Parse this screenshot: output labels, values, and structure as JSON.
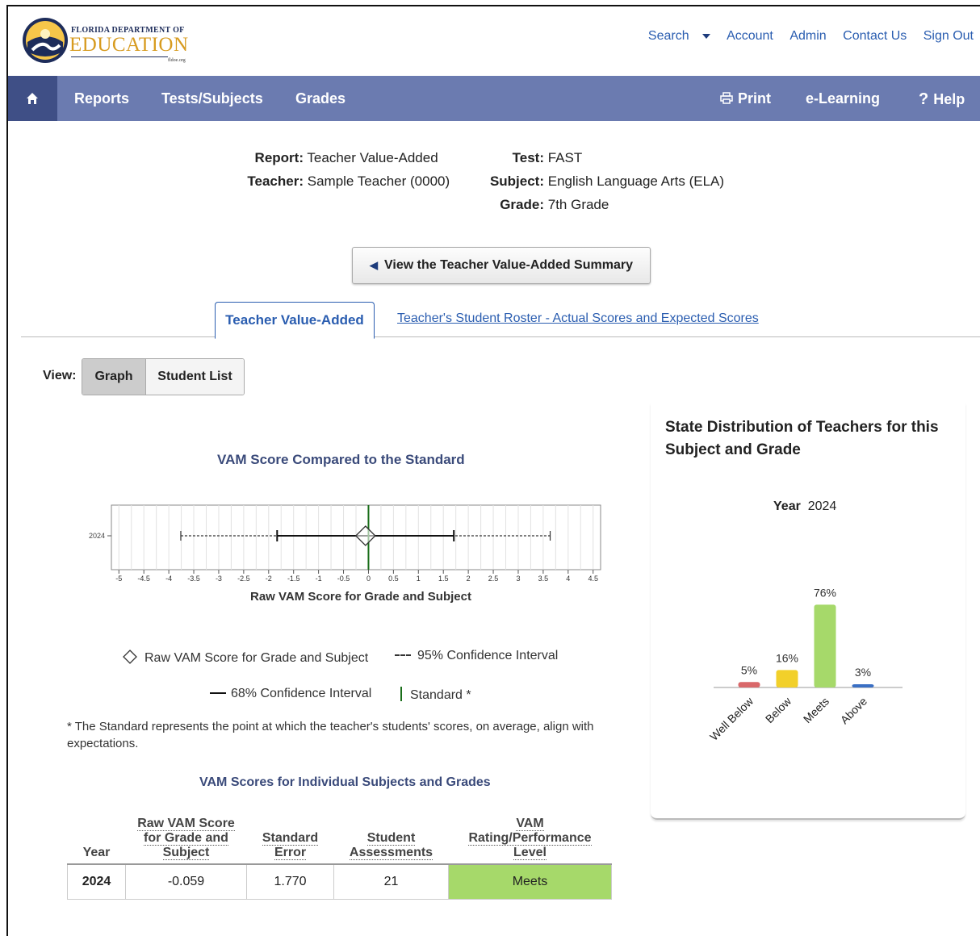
{
  "header": {
    "logo_line1": "FLORIDA DEPARTMENT OF",
    "logo_line2": "EDUCATION",
    "logo_line3": "fldoe.org",
    "links": {
      "search": "Search",
      "account": "Account",
      "admin": "Admin",
      "contact": "Contact Us",
      "signout": "Sign Out"
    }
  },
  "nav": {
    "reports": "Reports",
    "tests": "Tests/Subjects",
    "grades": "Grades",
    "print": "Print",
    "elearning": "e-Learning",
    "help": "Help"
  },
  "report": {
    "report_label": "Report:",
    "report_value": "Teacher Value-Added",
    "teacher_label": "Teacher:",
    "teacher_value": "Sample Teacher (0000)",
    "test_label": "Test:",
    "test_value": "FAST",
    "subject_label": "Subject:",
    "subject_value": "English Language Arts (ELA)",
    "grade_label": "Grade:",
    "grade_value": "7th Grade"
  },
  "summary_button": "View the Teacher Value-Added Summary",
  "tabs": {
    "active": "Teacher Value-Added",
    "other": "Teacher's Student Roster - Actual Scores and Expected Scores"
  },
  "view": {
    "label": "View:",
    "graph": "Graph",
    "list": "Student List"
  },
  "vam_chart": {
    "title": "VAM Score Compared to the Standard",
    "legend_diamond": "Raw VAM Score for Grade and Subject",
    "legend_95": "95% Confidence Interval",
    "legend_68": "68% Confidence Interval",
    "legend_std": "Standard *"
  },
  "note": "* The Standard represents the point at which the teacher's students' scores, on average, align with expectations.",
  "table": {
    "title": "VAM Scores for Individual Subjects and Grades",
    "headers": {
      "year": "Year",
      "raw1": "Raw VAM Score",
      "raw2": "for Grade and",
      "raw3": "Subject",
      "se1": "Standard",
      "se2": "Error",
      "sa1": "Student",
      "sa2": "Assessments",
      "r1": "VAM",
      "r2": "Rating/Performance",
      "r3": "Level"
    },
    "row": {
      "year": "2024",
      "raw": "-0.059",
      "se": "1.770",
      "sa": "21",
      "rating": "Meets"
    }
  },
  "panel": {
    "title": "State Distribution of Teachers for this Subject and Grade",
    "year_label": "Year",
    "year_value": "2024"
  },
  "chart_data": [
    {
      "type": "scatter",
      "title": "VAM Score Compared to the Standard",
      "xlabel": "Raw VAM Score for Grade and Subject",
      "ylabel": "",
      "categories": [
        "2024"
      ],
      "xlim": [
        -5,
        4.5
      ],
      "x_ticks": [
        "-5",
        "-4.5",
        "-4",
        "-3.5",
        "-3",
        "-2.5",
        "-2",
        "-1.5",
        "-1",
        "-0.5",
        "0",
        "0.5",
        "1",
        "1.5",
        "2",
        "2.5",
        "3",
        "3.5",
        "4",
        "4.5"
      ],
      "point": -0.059,
      "ci68": [
        -1.83,
        1.71
      ],
      "ci95": [
        -3.76,
        3.64
      ],
      "standard": 0,
      "grid": true
    },
    {
      "type": "bar",
      "title": "State Distribution of Teachers for this Subject and Grade",
      "categories": [
        "Well Below",
        "Below",
        "Meets",
        "Above"
      ],
      "values": [
        5,
        16,
        76,
        3
      ],
      "labels": [
        "5%",
        "16%",
        "76%",
        "3%"
      ],
      "colors": [
        "#d9686a",
        "#f2d02a",
        "#a6d96a",
        "#3a6fc4"
      ],
      "ylim": [
        0,
        100
      ]
    }
  ]
}
